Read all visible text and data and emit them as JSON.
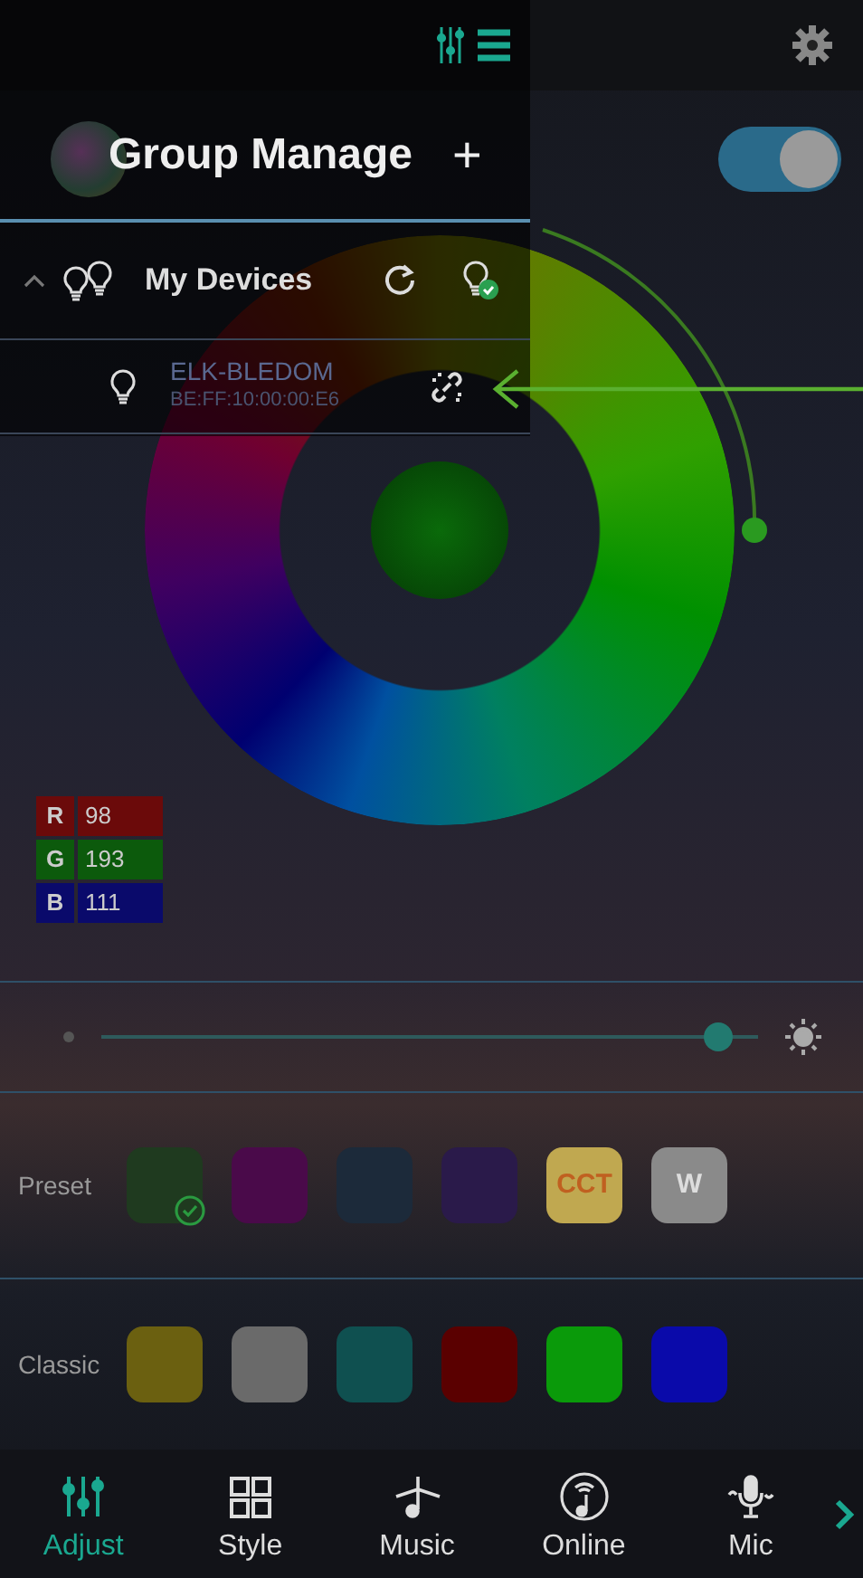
{
  "drawer": {
    "title": "Group Manage",
    "add_label": "+",
    "group": {
      "name": "My Devices",
      "expanded": true,
      "devices": [
        {
          "name": "ELK-BLEDOM",
          "address": "BE:FF:10:00:00:E6",
          "connected": false
        }
      ]
    }
  },
  "power": {
    "on": true
  },
  "rgb": [
    {
      "channel": "R",
      "value": "98",
      "color": "#6b0a0a"
    },
    {
      "channel": "G",
      "value": "193",
      "color": "#0c5a0c"
    },
    {
      "channel": "B",
      "value": "111",
      "color": "#0a0a6b"
    }
  ],
  "brightness": {
    "level": 0.94
  },
  "preset": {
    "label": "Preset",
    "swatches": [
      {
        "kind": "color",
        "color": "#1f3a1f",
        "selected": true
      },
      {
        "kind": "color",
        "color": "#4a0a4a",
        "selected": false
      },
      {
        "kind": "color",
        "color": "#1c2a3a",
        "selected": false
      },
      {
        "kind": "color",
        "color": "#2a1a4a",
        "selected": false
      },
      {
        "kind": "text",
        "color": "#c0a850",
        "text": "CCT",
        "selected": false
      },
      {
        "kind": "text",
        "color": "#8a8a8a",
        "text": "W",
        "selected": false
      }
    ]
  },
  "classic": {
    "label": "Classic",
    "swatches": [
      {
        "kind": "color",
        "color": "#6b6010",
        "selected": false
      },
      {
        "kind": "color",
        "color": "#6a6a6a",
        "selected": false
      },
      {
        "kind": "color",
        "color": "#0f5050",
        "selected": false
      },
      {
        "kind": "color",
        "color": "#5a0000",
        "selected": false
      },
      {
        "kind": "color",
        "color": "#0a9a0a",
        "selected": false
      },
      {
        "kind": "color",
        "color": "#0a0aaa",
        "selected": false
      }
    ]
  },
  "nav": [
    {
      "kind": "adjust",
      "label": "Adjust",
      "selected": true
    },
    {
      "kind": "style",
      "label": "Style",
      "selected": false
    },
    {
      "kind": "music",
      "label": "Music",
      "selected": false
    },
    {
      "kind": "online",
      "label": "Online",
      "selected": false
    },
    {
      "kind": "mic",
      "label": "Mic",
      "selected": false
    }
  ]
}
